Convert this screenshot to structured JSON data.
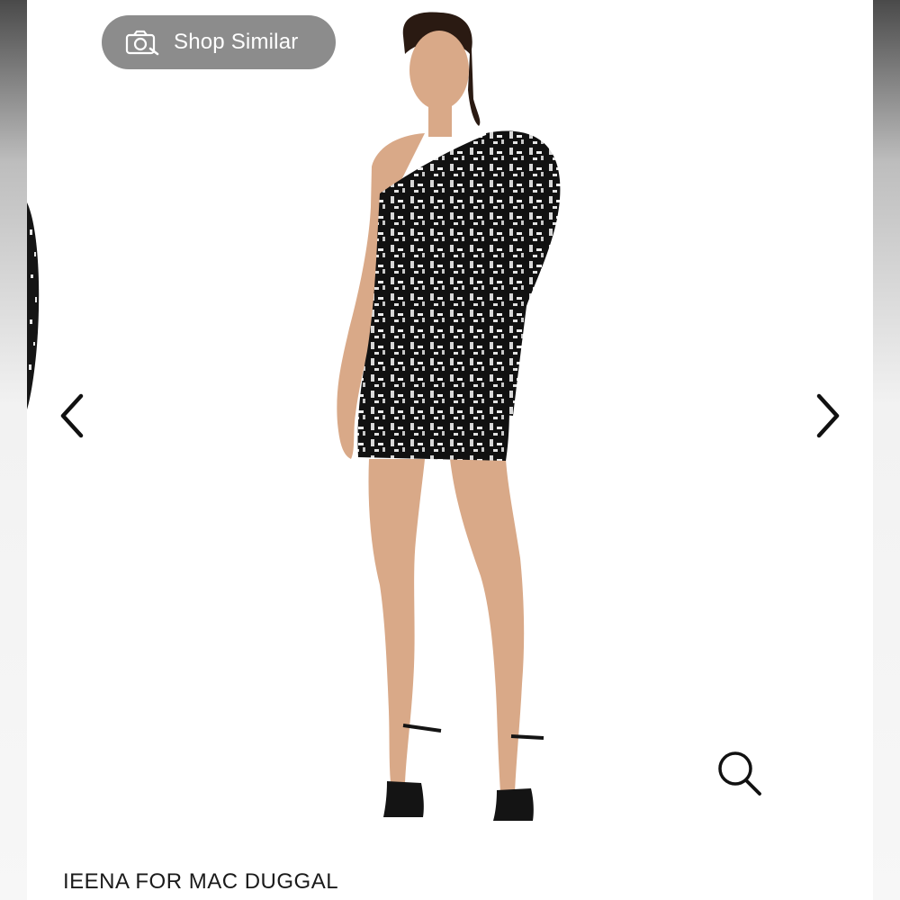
{
  "toolbar": {
    "shop_similar_label": "Shop Similar",
    "shop_similar_icon": "camera-search-icon"
  },
  "gallery": {
    "prev_icon": "chevron-left-icon",
    "next_icon": "chevron-right-icon",
    "zoom_icon": "magnifier-icon",
    "image_subject": "model wearing black embellished one-shoulder mini dress with puff sleeve",
    "dress_color": "#111111",
    "skin_color": "#d9a988",
    "shoe_color": "#141414"
  },
  "product": {
    "brand": "IEENA FOR MAC DUGGAL"
  },
  "colors": {
    "pill_background": "#8c8c8c",
    "pill_text": "#ffffff",
    "arrow": "#111111",
    "brand_text": "#1a1a1a"
  }
}
